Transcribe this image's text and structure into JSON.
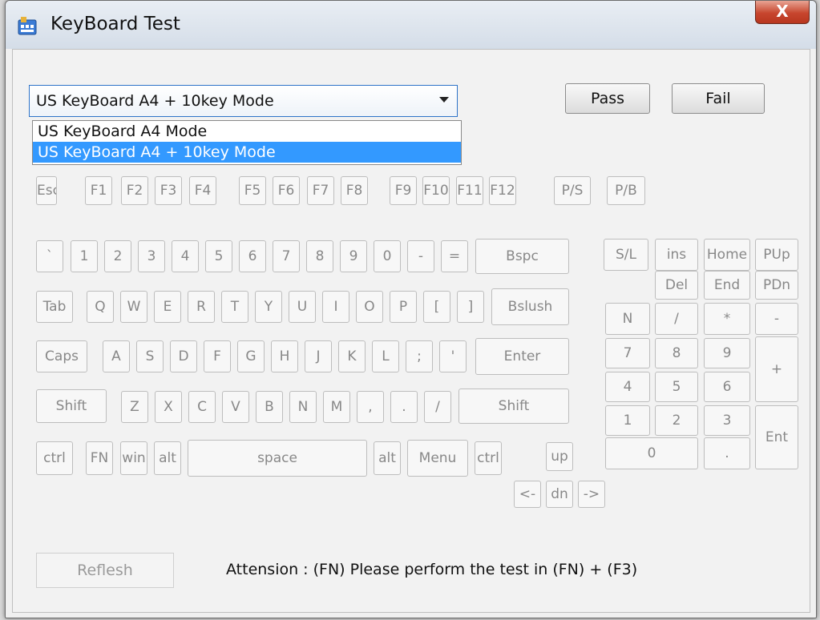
{
  "window": {
    "title": "KeyBoard Test",
    "close_label": "X"
  },
  "mode_select": {
    "value": "US KeyBoard A4 + 10key Mode",
    "options": [
      "US KeyBoard A4 Mode",
      "US KeyBoard A4 + 10key Mode"
    ],
    "selected_index": 1
  },
  "buttons": {
    "pass": "Pass",
    "fail": "Fail",
    "refresh": "Reflesh"
  },
  "attention": "Attension : (FN) Please perform the test in (FN) + (F3)",
  "keys": {
    "esc": "Esc",
    "f1": "F1",
    "f2": "F2",
    "f3": "F3",
    "f4": "F4",
    "f5": "F5",
    "f6": "F6",
    "f7": "F7",
    "f8": "F8",
    "f9": "F9",
    "f10": "F10",
    "f11": "F11",
    "f12": "F12",
    "ps": "P/S",
    "pb": "P/B",
    "backtick": "`",
    "d1": "1",
    "d2": "2",
    "d3": "3",
    "d4": "4",
    "d5": "5",
    "d6": "6",
    "d7": "7",
    "d8": "8",
    "d9": "9",
    "d0": "0",
    "minus": "-",
    "equal": "=",
    "bspc": "Bspc",
    "tab": "Tab",
    "q": "Q",
    "w": "W",
    "e": "E",
    "r": "R",
    "t": "T",
    "y": "Y",
    "u": "U",
    "i": "I",
    "o": "O",
    "p": "P",
    "lbracket": "[",
    "rbracket": "]",
    "bslush": "Bslush",
    "caps": "Caps",
    "a": "A",
    "s": "S",
    "d": "D",
    "f": "F",
    "g": "G",
    "h": "H",
    "j": "J",
    "k": "K",
    "l": "L",
    "semicolon": ";",
    "quote": "'",
    "enter": "Enter",
    "lshift": "Shift",
    "z": "Z",
    "x": "X",
    "c": "C",
    "v": "V",
    "b": "B",
    "n": "N",
    "m": "M",
    "comma": ",",
    "period": ".",
    "slash": "/",
    "rshift": "Shift",
    "lctrl": "ctrl",
    "fn": "FN",
    "win": "win",
    "lalt": "alt",
    "space": "space",
    "ralt": "alt",
    "menu": "Menu",
    "rctrl": "ctrl",
    "up": "up",
    "left": "<-",
    "down": "dn",
    "right": "->",
    "sl": "S/L",
    "ins": "ins",
    "home": "Home",
    "pup": "PUp",
    "del": "Del",
    "end": "End",
    "pdn": "PDn",
    "numlock": "N",
    "numdiv": "/",
    "nummul": "*",
    "numsub": "-",
    "num7": "7",
    "num8": "8",
    "num9": "9",
    "numadd": "+",
    "num4": "4",
    "num5": "5",
    "num6": "6",
    "num1": "1",
    "num2": "2",
    "num3": "3",
    "numenter": "Ent",
    "num0": "0",
    "numdot": "."
  }
}
